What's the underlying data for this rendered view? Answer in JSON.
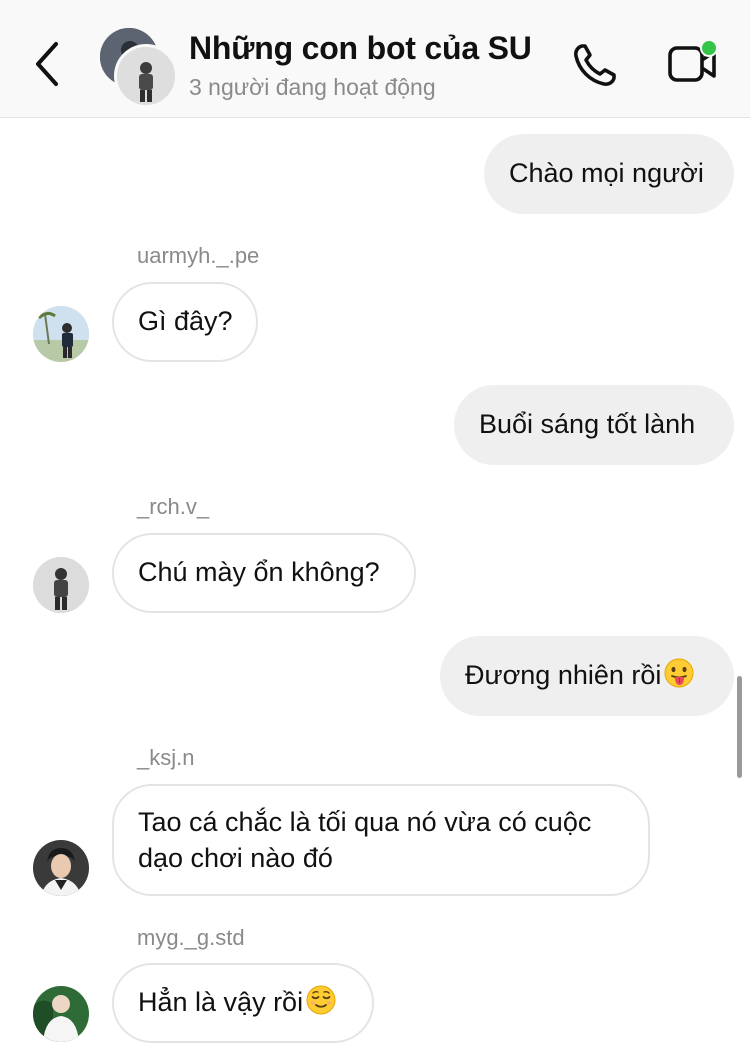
{
  "header": {
    "back_icon": "chevron-left-icon",
    "title": "Những con bot của SU",
    "subtitle": "3 người đang hoạt động",
    "call_icon": "phone-icon",
    "video_icon": "video-camera-icon",
    "online_color": "#33c548"
  },
  "messages": [
    {
      "direction": "outgoing",
      "text": "Chào mọi người"
    },
    {
      "direction": "incoming",
      "sender": "uarmyh._.pe",
      "text": "Gì đây?"
    },
    {
      "direction": "outgoing",
      "text": "Buổi sáng tốt lành"
    },
    {
      "direction": "incoming",
      "sender": "_rch.v_",
      "text": "Chú mày ổn không?"
    },
    {
      "direction": "outgoing",
      "text": "Đương nhiên rồi",
      "emoji": "tongue-out-emoji"
    },
    {
      "direction": "incoming",
      "sender": "_ksj.n",
      "line1": "Tao cá chắc là tối qua nó vừa có cuộc",
      "line2": "dạo chơi nào đó"
    },
    {
      "direction": "incoming",
      "sender": "myg._g.std",
      "text": "Hẳn là vậy rồi",
      "emoji": "relieved-face-emoji"
    }
  ],
  "colors": {
    "outgoing_bubble": "#efefef",
    "incoming_border": "#e4e4e4",
    "secondary_text": "#8a8a8a",
    "header_bg": "#f9f9f9"
  }
}
